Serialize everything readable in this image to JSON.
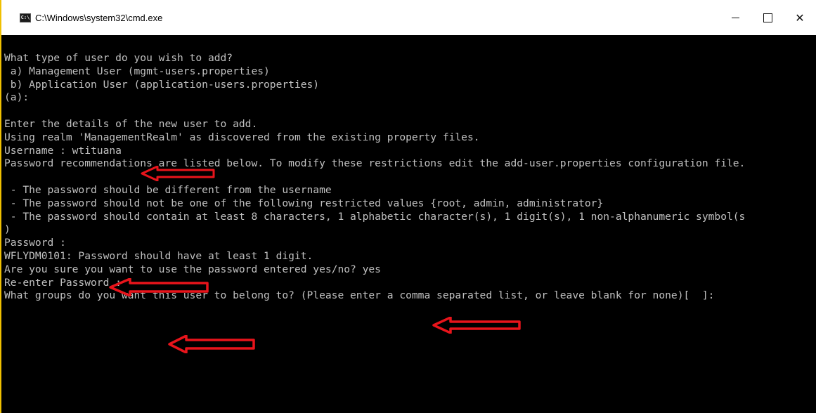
{
  "window": {
    "title": "C:\\Windows\\system32\\cmd.exe",
    "icon": "cmd-icon",
    "controls": [
      "minimize",
      "maximize",
      "close"
    ]
  },
  "console": {
    "lines": [
      "What type of user do you wish to add?",
      " a) Management User (mgmt-users.properties)",
      " b) Application User (application-users.properties)",
      "(a):",
      "",
      "Enter the details of the new user to add.",
      "Using realm 'ManagementRealm' as discovered from the existing property files.",
      "Username : wtituana",
      "Password recommendations are listed below. To modify these restrictions edit the add-user.properties configuration file.",
      "",
      " - The password should be different from the username",
      " - The password should not be one of the following restricted values {root, admin, administrator}",
      " - The password should contain at least 8 characters, 1 alphabetic character(s), 1 digit(s), 1 non-alphanumeric symbol(s",
      ")",
      "Password :",
      "WFLYDM0101: Password should have at least 1 digit.",
      "Are you sure you want to use the password entered yes/no? yes",
      "Re-enter Password :",
      "What groups do you want this user to belong to? (Please enter a comma separated list, or leave blank for none)[  ]:"
    ]
  },
  "annotations": {
    "arrow_color": "#e8141b",
    "arrows": [
      "username-arrow",
      "password-arrow",
      "yes-arrow",
      "reenter-password-arrow"
    ]
  }
}
